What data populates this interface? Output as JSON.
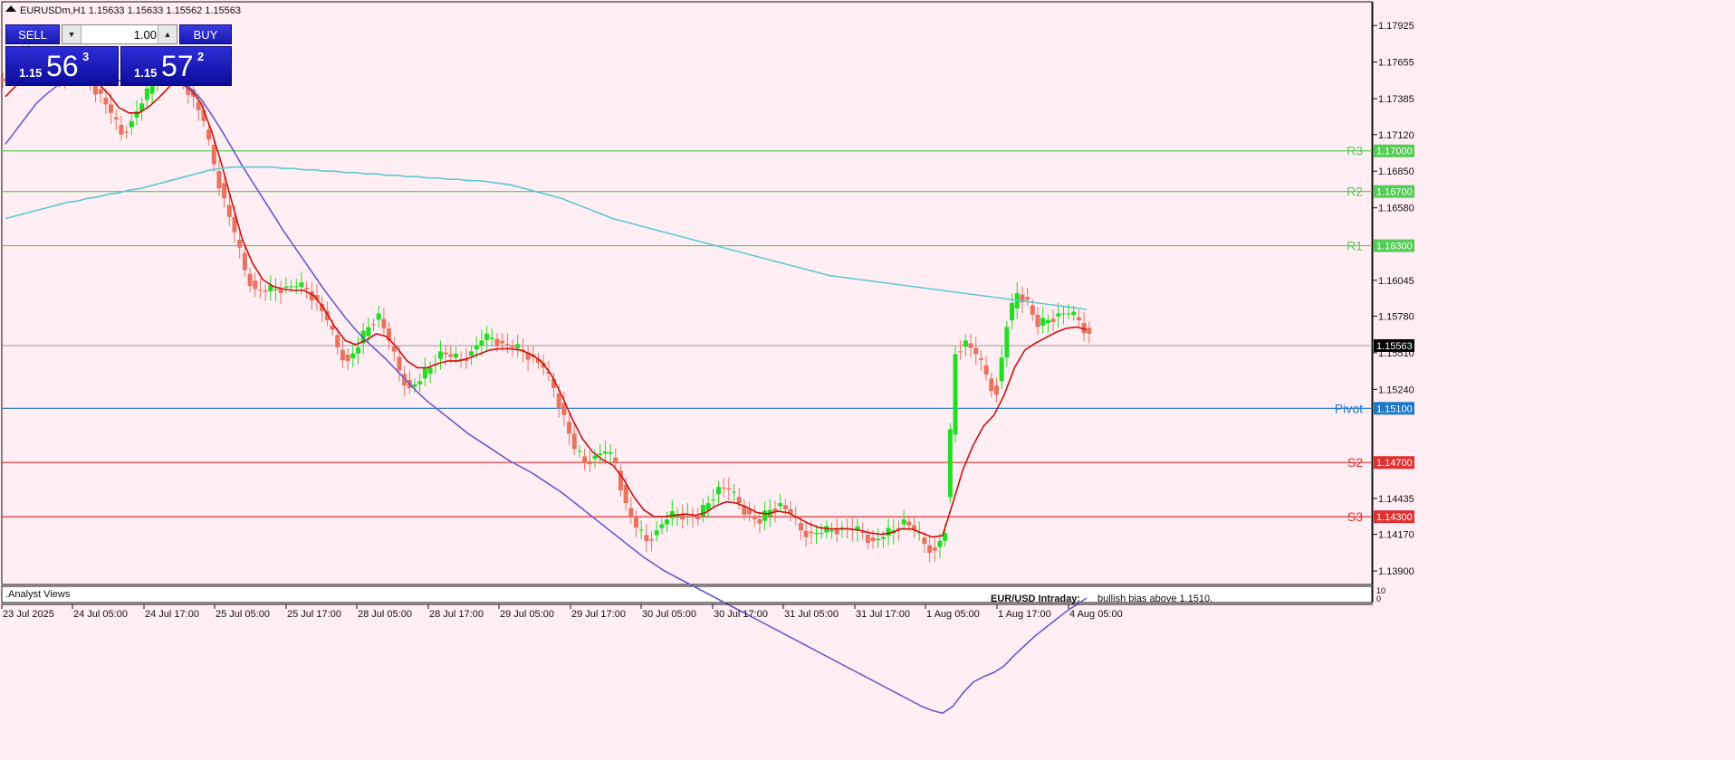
{
  "header": {
    "symbol_line": "EURUSDm,H1  1.15633 1.15633 1.15562 1.15563",
    "sell_label": "SELL",
    "buy_label": "BUY",
    "lot_value": "1.00",
    "sell_price_small": "1.15",
    "sell_price_big": "56",
    "sell_price_sup": "3",
    "buy_price_small": "1.15",
    "buy_price_big": "57",
    "buy_price_sup": "2"
  },
  "indicator_panel": {
    "label": ".Analyst Views",
    "scale_top": "10",
    "scale_bottom": "0",
    "text_title": "EUR/USD Intraday:",
    "text_body": "bullish bias above 1.1510."
  },
  "colors": {
    "background": "#ffeef4",
    "bull_candle": "#22dd22",
    "bear_candle": "#e8735f",
    "ma_fast": "#cc1111",
    "ma_mid": "#6a5acd",
    "ma_slow": "#5ec8d0",
    "resistance": "#55cc55",
    "pivot": "#1e78c8",
    "support": "#e03030"
  },
  "chart_data": {
    "type": "candlestick",
    "title": "EURUSDm,H1",
    "ylim": [
      1.138,
      1.181
    ],
    "y_ticks": [
      "1.17925",
      "1.17655",
      "1.17385",
      "1.17120",
      "1.16850",
      "1.16580",
      "1.16045",
      "1.15780",
      "1.15510",
      "1.15240",
      "1.14435",
      "1.14170",
      "1.13900"
    ],
    "x_ticks": [
      "23 Jul 2025",
      "24 Jul 05:00",
      "24 Jul 17:00",
      "25 Jul 05:00",
      "25 Jul 17:00",
      "28 Jul 05:00",
      "28 Jul 17:00",
      "29 Jul 05:00",
      "29 Jul 17:00",
      "30 Jul 05:00",
      "30 Jul 17:00",
      "31 Jul 05:00",
      "31 Jul 17:00",
      "1 Aug 05:00",
      "1 Aug 17:00",
      "4 Aug 05:00"
    ],
    "current_price": {
      "label": "1.15563",
      "value": 1.15563
    },
    "levels": [
      {
        "name": "R3",
        "value": 1.17,
        "label": "1.17000",
        "kind": "resistance"
      },
      {
        "name": "R2",
        "value": 1.167,
        "label": "1.16700",
        "kind": "resistance"
      },
      {
        "name": "R1",
        "value": 1.163,
        "label": "1.16300",
        "kind": "resistance"
      },
      {
        "name": "Pivot",
        "value": 1.151,
        "label": "1.15100",
        "kind": "pivot"
      },
      {
        "name": "S2",
        "value": 1.147,
        "label": "1.14700",
        "kind": "support"
      },
      {
        "name": "S3",
        "value": 1.143,
        "label": "1.14300",
        "kind": "support"
      }
    ],
    "close_path": [
      1.1758,
      1.1764,
      1.177,
      1.1766,
      1.1758,
      1.1753,
      1.176,
      1.1757,
      1.175,
      1.1742,
      1.1728,
      1.1712,
      1.1722,
      1.1735,
      1.1748,
      1.1768,
      1.1762,
      1.1752,
      1.174,
      1.1722,
      1.169,
      1.1665,
      1.164,
      1.1612,
      1.1598,
      1.1596,
      1.1598,
      1.16,
      1.16,
      1.1598,
      1.159,
      1.1575,
      1.1555,
      1.1545,
      1.1555,
      1.157,
      1.158,
      1.156,
      1.1538,
      1.1525,
      1.153,
      1.154,
      1.1552,
      1.1548,
      1.1545,
      1.1552,
      1.156,
      1.1562,
      1.1558,
      1.1555,
      1.1552,
      1.1548,
      1.154,
      1.1525,
      1.1505,
      1.148,
      1.147,
      1.1475,
      1.1478,
      1.147,
      1.144,
      1.1422,
      1.1412,
      1.142,
      1.1428,
      1.1432,
      1.1432,
      1.1428,
      1.144,
      1.1452,
      1.145,
      1.144,
      1.1432,
      1.1425,
      1.1435,
      1.144,
      1.1432,
      1.142,
      1.1418,
      1.1418,
      1.142,
      1.1422,
      1.142,
      1.1418,
      1.1412,
      1.1415,
      1.142,
      1.1428,
      1.142,
      1.141,
      1.1405,
      1.1418,
      1.155,
      1.156,
      1.155,
      1.1535,
      1.152,
      1.157,
      1.1595,
      1.159,
      1.157,
      1.1575,
      1.158,
      1.158,
      1.1575,
      1.1565
    ],
    "series": [
      {
        "name": "",
        "kind": "ma_fast",
        "values": [
          1.174,
          1.1748,
          1.1755,
          1.176,
          1.1762,
          1.1762,
          1.176,
          1.1758,
          1.1755,
          1.175,
          1.1742,
          1.1732,
          1.1728,
          1.1728,
          1.1733,
          1.174,
          1.1748,
          1.175,
          1.1745,
          1.1735,
          1.1715,
          1.169,
          1.1662,
          1.1635,
          1.1617,
          1.1605,
          1.16,
          1.1598,
          1.1597,
          1.1597,
          1.1593,
          1.1583,
          1.157,
          1.156,
          1.1557,
          1.156,
          1.1565,
          1.1563,
          1.1555,
          1.1545,
          1.154,
          1.154,
          1.1543,
          1.1545,
          1.1545,
          1.1547,
          1.155,
          1.1553,
          1.1554,
          1.1554,
          1.1553,
          1.155,
          1.1545,
          1.1535,
          1.152,
          1.1503,
          1.1488,
          1.1478,
          1.1472,
          1.1468,
          1.1458,
          1.1445,
          1.1435,
          1.143,
          1.143,
          1.1431,
          1.1432,
          1.1431,
          1.1433,
          1.1438,
          1.1441,
          1.144,
          1.1437,
          1.1433,
          1.1432,
          1.1434,
          1.1433,
          1.1429,
          1.1425,
          1.1422,
          1.1421,
          1.1421,
          1.1421,
          1.142,
          1.1418,
          1.1417,
          1.1418,
          1.1421,
          1.1421,
          1.1418,
          1.1415,
          1.1416,
          1.144,
          1.1465,
          1.1483,
          1.1497,
          1.1505,
          1.152,
          1.154,
          1.1553,
          1.1558,
          1.1562,
          1.1566,
          1.1569,
          1.157,
          1.1568
        ]
      },
      {
        "name": "",
        "kind": "ma_mid",
        "values": [
          1.1705,
          1.1715,
          1.1725,
          1.1735,
          1.1742,
          1.1748,
          1.1753,
          1.1756,
          1.1757,
          1.1757,
          1.1755,
          1.1752,
          1.175,
          1.175,
          1.1751,
          1.1752,
          1.1752,
          1.175,
          1.1746,
          1.1738,
          1.1727,
          1.1715,
          1.1702,
          1.1689,
          1.1677,
          1.1665,
          1.1653,
          1.1641,
          1.163,
          1.1619,
          1.1608,
          1.1597,
          1.1587,
          1.1577,
          1.1568,
          1.156,
          1.1553,
          1.1546,
          1.1538,
          1.153,
          1.1522,
          1.1515,
          1.1509,
          1.1503,
          1.1497,
          1.1491,
          1.1486,
          1.1481,
          1.1476,
          1.1471,
          1.1467,
          1.1463,
          1.1458,
          1.1453,
          1.1448,
          1.1442,
          1.1436,
          1.143,
          1.1424,
          1.1418,
          1.1412,
          1.1406,
          1.14,
          1.1395,
          1.139,
          1.1386,
          1.1382,
          1.1378,
          1.1374,
          1.137,
          1.1366,
          1.1362,
          1.1358,
          1.1354,
          1.135,
          1.1346,
          1.1342,
          1.1338,
          1.1334,
          1.133,
          1.1326,
          1.1322,
          1.1318,
          1.1314,
          1.131,
          1.1306,
          1.1302,
          1.1298,
          1.1294,
          1.129,
          1.1287,
          1.1285,
          1.129,
          1.13,
          1.1308,
          1.1312,
          1.1315,
          1.132,
          1.1328,
          1.1335,
          1.1342,
          1.1348,
          1.1354,
          1.136,
          1.1365,
          1.137
        ]
      },
      {
        "name": "",
        "kind": "ma_slow",
        "values": [
          1.165,
          1.1652,
          1.1654,
          1.1656,
          1.1658,
          1.166,
          1.1662,
          1.1663,
          1.1665,
          1.1666,
          1.1668,
          1.1669,
          1.1671,
          1.1672,
          1.1674,
          1.1676,
          1.1678,
          1.168,
          1.1682,
          1.1684,
          1.1686,
          1.1687,
          1.1688,
          1.1688,
          1.1688,
          1.1688,
          1.1688,
          1.1687,
          1.1687,
          1.1686,
          1.1686,
          1.1685,
          1.1685,
          1.1684,
          1.1684,
          1.1683,
          1.1683,
          1.1682,
          1.1682,
          1.1681,
          1.1681,
          1.168,
          1.168,
          1.1679,
          1.1679,
          1.1678,
          1.1678,
          1.1677,
          1.1676,
          1.1675,
          1.1673,
          1.1671,
          1.1669,
          1.1667,
          1.1665,
          1.1662,
          1.1659,
          1.1656,
          1.1653,
          1.165,
          1.1648,
          1.1646,
          1.1644,
          1.1642,
          1.164,
          1.1638,
          1.1636,
          1.1634,
          1.1632,
          1.163,
          1.1628,
          1.1626,
          1.1624,
          1.1622,
          1.162,
          1.1618,
          1.1616,
          1.1614,
          1.1612,
          1.161,
          1.1608,
          1.1607,
          1.1606,
          1.1605,
          1.1604,
          1.1603,
          1.1602,
          1.1601,
          1.16,
          1.1599,
          1.1598,
          1.1597,
          1.1596,
          1.1595,
          1.1594,
          1.1593,
          1.1592,
          1.1591,
          1.159,
          1.1589,
          1.1588,
          1.1587,
          1.1586,
          1.1585,
          1.1584,
          1.1583
        ]
      }
    ]
  }
}
